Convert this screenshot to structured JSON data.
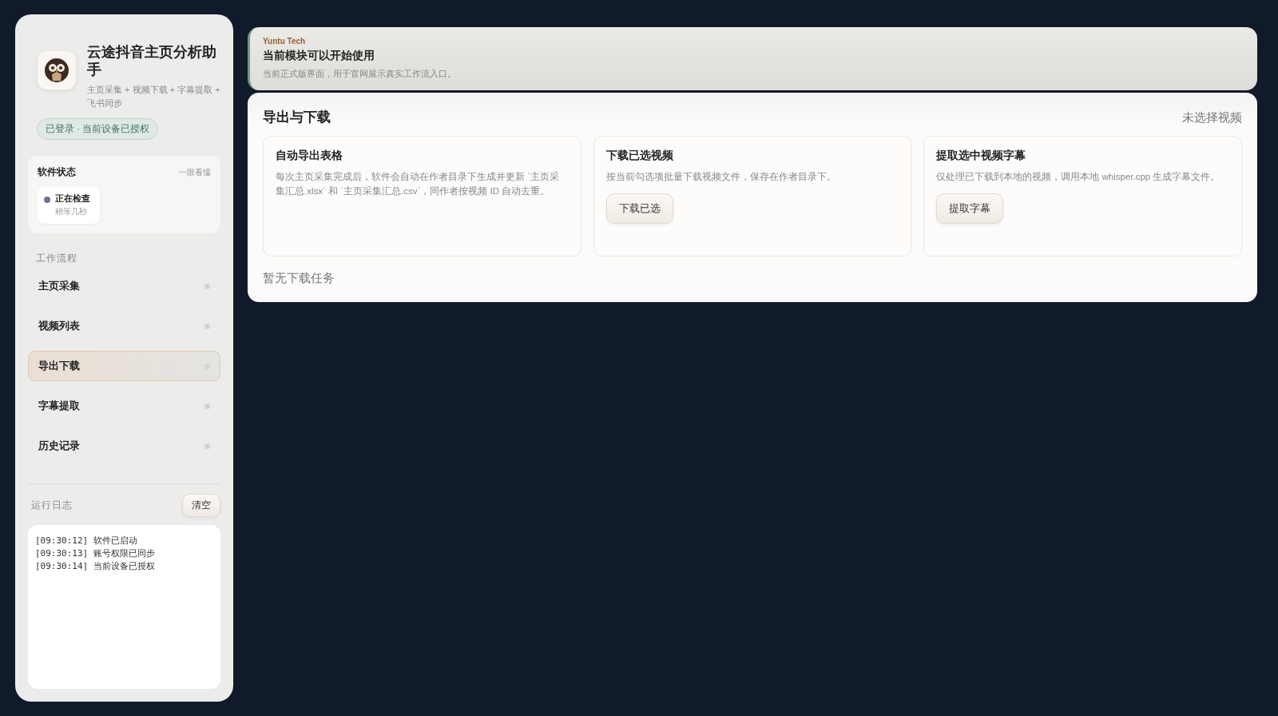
{
  "app": {
    "title": "云途抖音主页分析助手",
    "subtitle": "主页采集 + 视频下载 + 字幕提取 + 飞书同步",
    "auth_badge": "已登录 · 当前设备已授权"
  },
  "software_status": {
    "title": "软件状态",
    "hint": "一眼看懂",
    "status": "正在检查",
    "detail": "稍等几秒"
  },
  "workflow": {
    "title": "工作流程",
    "items": [
      {
        "label": "主页采集",
        "selected": false
      },
      {
        "label": "视频列表",
        "selected": false
      },
      {
        "label": "导出下载",
        "selected": true
      },
      {
        "label": "字幕提取",
        "selected": false
      },
      {
        "label": "历史记录",
        "selected": false
      }
    ]
  },
  "log": {
    "title": "运行日志",
    "clear_button": "清空",
    "entries": [
      "[09:30:12] 软件已启动",
      "[09:30:13] 账号权限已同步",
      "[09:30:14] 当前设备已授权"
    ]
  },
  "banner": {
    "brand": "Yuntu Tech",
    "title": "当前模块可以开始使用",
    "text": "当前正式版界面，用于官网展示真实工作流入口。"
  },
  "panel": {
    "title": "导出与下载",
    "selection": "未选择视频",
    "cards": [
      {
        "title": "自动导出表格",
        "text": "每次主页采集完成后，软件会自动在作者目录下生成并更新 `主页采集汇总.xlsx` 和 `主页采集汇总.csv`，同作者按视频 ID 自动去重。"
      },
      {
        "title": "下载已选视频",
        "text": "按当前勾选项批量下载视频文件，保存在作者目录下。",
        "button": "下载已选"
      },
      {
        "title": "提取选中视频字幕",
        "text": "仅处理已下载到本地的视频，调用本地 whisper.cpp 生成字幕文件。",
        "button": "提取字幕"
      }
    ],
    "empty": "暂无下载任务"
  }
}
